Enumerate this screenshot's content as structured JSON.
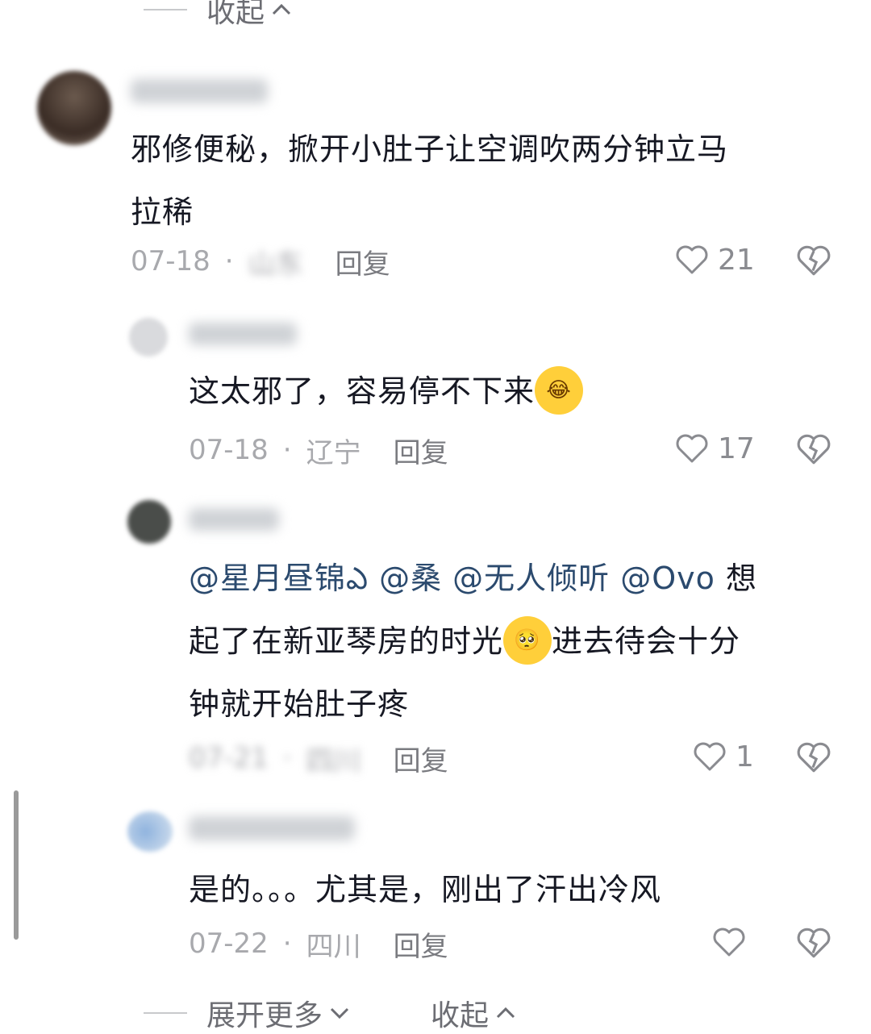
{
  "top_fold": {
    "label": "收起",
    "chevron": "chevron-up-icon"
  },
  "comments": [
    {
      "text_line1": "邪修便秘，掀开小肚子让空调吹两分钟立马",
      "text_line2": "拉稀",
      "date": "07-18",
      "location": "山东",
      "reply": "回复",
      "likes": "21"
    },
    {
      "text": "这太邪了，容易停不下来",
      "emoji": "crying-laughing-emoji",
      "date": "07-18",
      "location": "辽宁",
      "reply": "回复",
      "likes": "17"
    },
    {
      "mentions": "@星月昼锦ఎ @桑 @无人倾听 @Ovo",
      "text_line1_tail": "想",
      "text_line2": "起了在新亚琴房的时光",
      "text_line2_tail": "进去待会十分",
      "text_line3": "钟就开始肚子疼",
      "emoji": "pleading-face-emoji",
      "date": "07-21",
      "location": "四川",
      "reply": "回复",
      "likes": "1"
    },
    {
      "text": "是的。。。尤其是，刚出了汗出冷风",
      "date": "07-22",
      "location": "四川",
      "reply": "回复",
      "likes": ""
    }
  ],
  "bottom_bar": {
    "expand_label": "展开更多",
    "collapse_label": "收起"
  },
  "icons": [
    "heart-icon",
    "dislike-heart-icon",
    "chevron-down-icon",
    "chevron-up-icon"
  ],
  "colors": {
    "text": "#161823",
    "meta": "#a8a9ad",
    "mention": "#2b4a6e"
  }
}
